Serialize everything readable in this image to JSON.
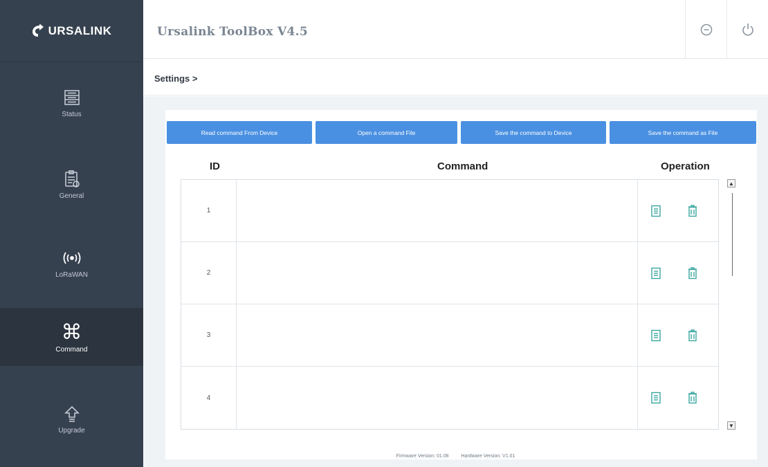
{
  "brand": {
    "logo_text": "URSALINK"
  },
  "header": {
    "title": "Ursalink ToolBox V4.5"
  },
  "sidebar": {
    "items": [
      {
        "label": "Status",
        "icon": "status-icon"
      },
      {
        "label": "General",
        "icon": "general-icon"
      },
      {
        "label": "LoRaWAN",
        "icon": "wireless-icon"
      },
      {
        "label": "Command",
        "icon": "command-icon",
        "active": true
      },
      {
        "label": "Upgrade",
        "icon": "upgrade-icon"
      }
    ]
  },
  "breadcrumb": {
    "text": "Settings >"
  },
  "toolbar": {
    "read_label": "Read command From Device",
    "open_label": "Open a command File",
    "save_device_label": "Save the command to Device",
    "save_file_label": "Save the command as File"
  },
  "table": {
    "columns": [
      "ID",
      "Command",
      "Operation"
    ],
    "rows": [
      {
        "id": "1",
        "command": ""
      },
      {
        "id": "2",
        "command": ""
      },
      {
        "id": "3",
        "command": ""
      },
      {
        "id": "4",
        "command": ""
      }
    ]
  },
  "footer": {
    "firmware": "Firmware Version: 01.08",
    "hardware": "Hardware Version: V1.01"
  },
  "colors": {
    "sidebar_bg": "#36414f",
    "sidebar_active": "#2b343f",
    "accent": "#4a90e2",
    "icon_teal": "#3aa6a0"
  }
}
